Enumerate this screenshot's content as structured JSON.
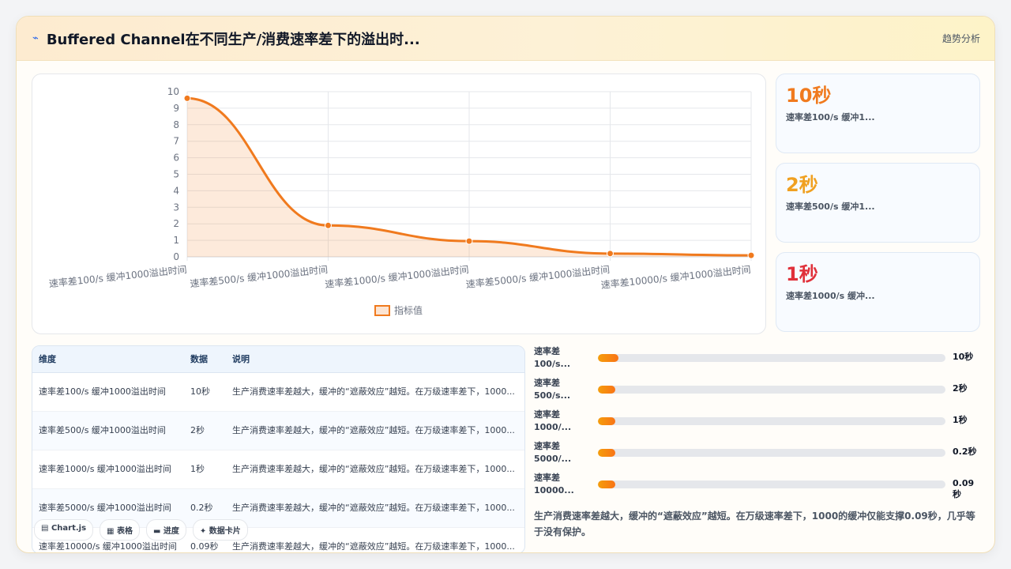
{
  "header": {
    "icon": "trend-line-icon",
    "title": "Buffered Channel在不同生产/消费速率差下的溢出时...",
    "tag": "趋势分析"
  },
  "colors": {
    "line": "#f07a1e",
    "area": "rgba(240,122,30,0.16)",
    "stat1": "#f07a1e",
    "stat2": "#f0a020",
    "stat3": "#e0303a"
  },
  "chart_data": {
    "type": "line",
    "categories": [
      "速率差100/s 缓冲1000溢出时间",
      "速率差500/s 缓冲1000溢出时间",
      "速率差1000/s 缓冲1000溢出时间",
      "速率差5000/s 缓冲1000溢出时间",
      "速率差10000/s 缓冲1000溢出时间"
    ],
    "series": [
      {
        "name": "指标值",
        "values": [
          9.6,
          1.9,
          0.95,
          0.2,
          0.09
        ]
      }
    ],
    "ylim": [
      0,
      10
    ],
    "yticks": [
      "0",
      "1",
      "2",
      "3",
      "4",
      "5",
      "6",
      "7",
      "8",
      "9",
      "10"
    ],
    "grid": true,
    "legend": "bottom",
    "fill": true
  },
  "stats": [
    {
      "value": "10秒",
      "label": "速率差100/s 缓冲1..."
    },
    {
      "value": "2秒",
      "label": "速率差500/s 缓冲1..."
    },
    {
      "value": "1秒",
      "label": "速率差1000/s 缓冲..."
    }
  ],
  "table": {
    "headers": [
      "维度",
      "数据",
      "说明"
    ],
    "rows": [
      {
        "dim": "速率差100/s 缓冲1000溢出时间",
        "val": "10秒",
        "desc": "生产消费速率差越大，缓冲的“遮蔽效应”越短。在万级速率差下，1000..."
      },
      {
        "dim": "速率差500/s 缓冲1000溢出时间",
        "val": "2秒",
        "desc": "生产消费速率差越大，缓冲的“遮蔽效应”越短。在万级速率差下，1000..."
      },
      {
        "dim": "速率差1000/s 缓冲1000溢出时间",
        "val": "1秒",
        "desc": "生产消费速率差越大，缓冲的“遮蔽效应”越短。在万级速率差下，1000..."
      },
      {
        "dim": "速率差5000/s 缓冲1000溢出时间",
        "val": "0.2秒",
        "desc": "生产消费速率差越大，缓冲的“遮蔽效应”越短。在万级速率差下，1000..."
      },
      {
        "dim": "速率差10000/s 缓冲1000溢出时间",
        "val": "0.09秒",
        "desc": "生产消费速率差越大，缓冲的“遮蔽效应”越短。在万级速率差下，1000..."
      }
    ]
  },
  "progress": [
    {
      "label": "速率差100/s...",
      "value": "10秒",
      "level": 0.06
    },
    {
      "label": "速率差500/s...",
      "value": "2秒",
      "level": 0.05
    },
    {
      "label": "速率差1000/...",
      "value": "1秒",
      "level": 0.05
    },
    {
      "label": "速率差5000/...",
      "value": "0.2秒",
      "level": 0.05
    },
    {
      "label": "速率差10000...",
      "value": "0.09秒",
      "level": 0.05
    }
  ],
  "summary": "生产消费速率差越大，缓冲的“遮蔽效应”越短。在万级速率差下，1000的缓冲仅能支撑0.09秒，几乎等于没有保护。",
  "tabs": [
    {
      "icon": "chart-icon",
      "glyph": "▤",
      "label": "Chart.js"
    },
    {
      "icon": "table-icon",
      "glyph": "▦",
      "label": "表格"
    },
    {
      "icon": "progress-icon",
      "glyph": "▬",
      "label": "进度"
    },
    {
      "icon": "card-icon",
      "glyph": "✦",
      "label": "数据卡片"
    }
  ]
}
